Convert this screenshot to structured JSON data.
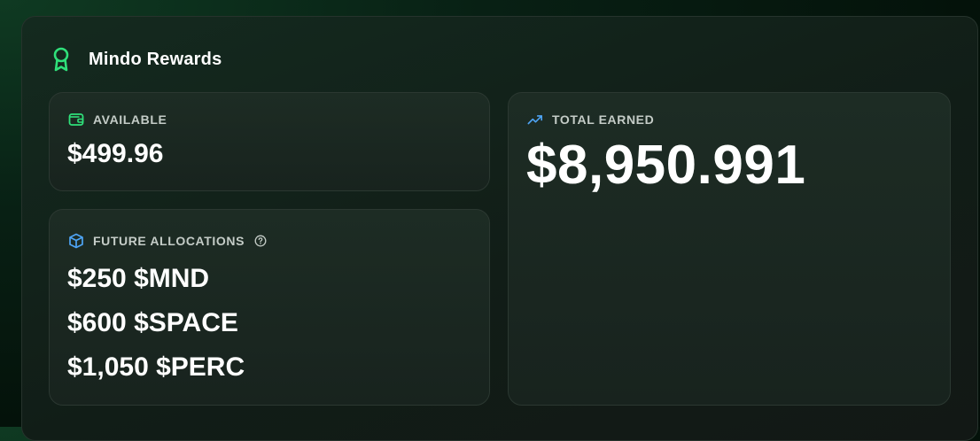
{
  "header": {
    "title": "Mindo Rewards",
    "icon": "award-ribbon-icon"
  },
  "available": {
    "label": "AVAILABLE",
    "value": "$499.96",
    "icon": "wallet-icon"
  },
  "future_allocations": {
    "label": "FUTURE ALLOCATIONS",
    "icon": "cube-icon",
    "help_icon": "question-circle-icon",
    "items": [
      {
        "text": "$250 $MND"
      },
      {
        "text": "$600 $SPACE"
      },
      {
        "text": "$1,050 $PERC"
      }
    ]
  },
  "total_earned": {
    "label": "TOTAL EARNED",
    "value": "$8,950.991",
    "icon": "trending-up-icon"
  },
  "colors": {
    "accent_green": "#2fe07a",
    "accent_blue": "#4ea4f5",
    "label_gray": "#c4ccc7"
  }
}
